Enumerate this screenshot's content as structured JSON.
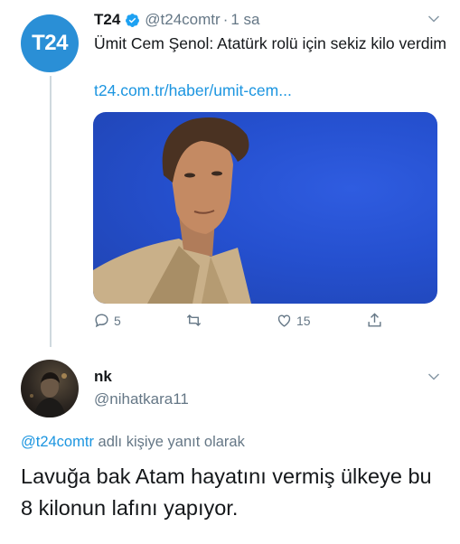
{
  "tweet": {
    "avatar_text": "T24",
    "name": "T24",
    "handle": "@t24comtr",
    "separator": "·",
    "time": "1 sa",
    "text": "Ümit Cem Şenol: Atatürk rolü için sekiz kilo verdim",
    "link": "t24.com.tr/haber/umit-cem...",
    "actions": {
      "reply_count": "5",
      "retweet_count": "",
      "like_count": "15"
    }
  },
  "reply": {
    "name": "nk",
    "handle": "@nihatkara11",
    "replying_to_mention": "@t24comtr",
    "replying_to_suffix": "adlı kişiye yanıt olarak",
    "text": "Lavuğa bak Atam hayatını vermiş ülkeye bu 8 kilonun lafını yapıyor."
  },
  "colors": {
    "accent": "#1b95e0",
    "secondary_text": "#657786",
    "avatar_t24": "#2a8fd6",
    "media_background": "#2550cf"
  },
  "icons": [
    "verified-badge-icon",
    "chevron-down-icon",
    "reply-icon",
    "retweet-icon",
    "like-icon",
    "share-icon"
  ]
}
